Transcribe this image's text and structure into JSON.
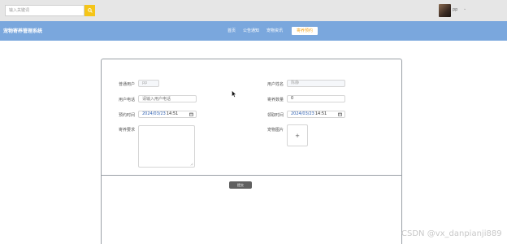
{
  "search": {
    "placeholder": "输入关键词"
  },
  "user": {
    "name": "pp"
  },
  "brand": {
    "title": "宠物寄养管理系统"
  },
  "nav": {
    "items": [
      "首页",
      "公告通知",
      "宠物资讯",
      "寄养预约"
    ],
    "active_index": 3
  },
  "form": {
    "account_label": "普通用户",
    "account_value": "pp",
    "name_label": "用户姓名",
    "name_value": "陈静",
    "phone_label": "用户电话",
    "phone_placeholder": "请输入用户电话",
    "qty_label": "寄养数量",
    "qty_value": "0",
    "appoint_label": "预约时间",
    "appoint_date": "2024/03/23",
    "appoint_time": "14:51",
    "pickup_label": "领取时间",
    "pickup_date": "2024/03/23",
    "pickup_time": "14:51",
    "req_label": "寄养要求",
    "photo_label": "宠物图片",
    "upload_symbol": "+",
    "submit_label": "提交"
  },
  "watermark": "CSDN @vx_danpianji889",
  "colors": {
    "navbar": "#7aa7dd",
    "accent": "#f5c518",
    "active_nav_text": "#f5a623",
    "submit": "#5f5f5f"
  }
}
